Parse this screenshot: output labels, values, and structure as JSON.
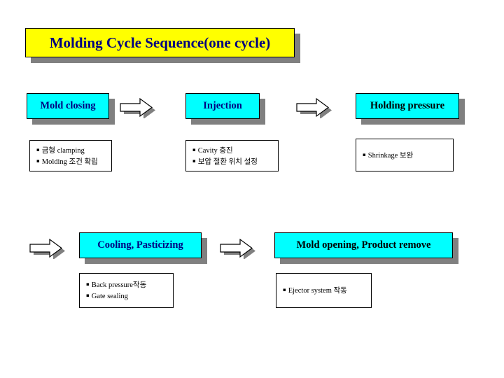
{
  "slide": {
    "title": "Molding Cycle Sequence(one cycle)",
    "title_bg": "#ffff00",
    "title_color": "#000080",
    "stage_bg": "#00ffff",
    "shadow_color": "#808080"
  },
  "stages": [
    {
      "id": "mold-closing",
      "label": "Mold closing",
      "label_color": "#000080",
      "details": [
        "금형 clamping",
        "Molding 조건 확립"
      ]
    },
    {
      "id": "injection",
      "label": "Injection",
      "label_color": "#000080",
      "details": [
        "Cavity 충진",
        "보압 절환 위치 설정"
      ]
    },
    {
      "id": "holding-pressure",
      "label": "Holding pressure",
      "label_color": "#000000",
      "details": [
        "Shrinkage 보완"
      ]
    },
    {
      "id": "cooling-pasticizing",
      "label": "Cooling, Pasticizing",
      "label_color": "#000080",
      "details": [
        "Back pressure작동",
        "Gate sealing"
      ]
    },
    {
      "id": "mold-opening-product-remove",
      "label": "Mold opening, Product remove",
      "label_color": "#000000",
      "details": [
        "Ejector system 작동"
      ]
    }
  ],
  "arrows": [
    {
      "id": "arrow-1",
      "name": "right-arrow-icon"
    },
    {
      "id": "arrow-2",
      "name": "right-arrow-icon"
    },
    {
      "id": "arrow-3",
      "name": "right-arrow-icon"
    },
    {
      "id": "arrow-4",
      "name": "right-arrow-icon"
    }
  ],
  "bullet": "▪"
}
